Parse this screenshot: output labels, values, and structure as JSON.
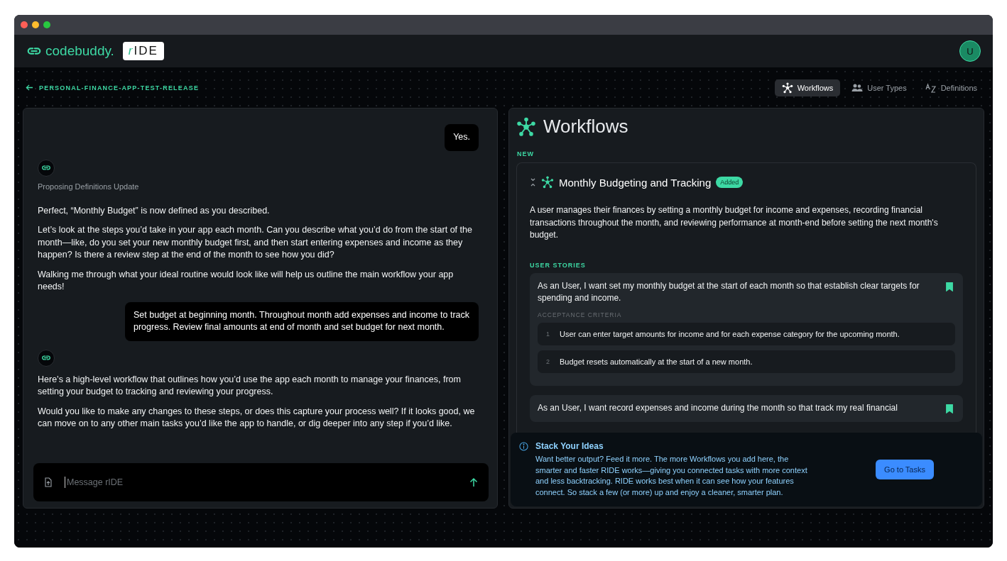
{
  "header": {
    "brand": "codebuddy.",
    "logo_prefix": "r",
    "logo_text": "IDE",
    "avatar": "U"
  },
  "breadcrumb": "PERSONAL-FINANCE-APP-TEST-RELEASE",
  "tabs": [
    {
      "kind": "workflows",
      "label": "Workflows",
      "selected": true
    },
    {
      "kind": "users",
      "label": "User Types",
      "selected": false
    },
    {
      "kind": "definitions",
      "label": "Definitions",
      "selected": false
    }
  ],
  "chat": {
    "messages": [
      {
        "kind": "user",
        "text": "Yes."
      },
      {
        "kind": "assistant",
        "status": "Proposing Definitions Update",
        "paragraphs": [
          "Perfect, “Monthly Budget” is now defined as you described.",
          "Let’s look at the steps you’d take in your app each month. Can you describe what you’d do from the start of the month—like, do you set your new monthly budget first, and then start entering expenses and income as they happen? Is there a review step at the end of the month to see how you did?",
          "Walking me through what your ideal routine would look like will help us outline the main workflow your app needs!"
        ]
      },
      {
        "kind": "user",
        "text": "Set budget at beginning month. Throughout month add expenses and income to track progress. Review final amounts at end of month and set budget for next month."
      },
      {
        "kind": "assistant",
        "paragraphs": [
          "Here’s a high-level workflow that outlines how you’d use the app each month to manage your finances, from setting your budget to tracking and reviewing your progress.",
          "Would you like to make any changes to these steps, or does this capture your process well? If it looks good, we can move on to any other main tasks you’d like the app to handle, or dig deeper into any step if you’d like."
        ]
      }
    ],
    "input": {
      "placeholder": "Message rIDE"
    }
  },
  "workflows": {
    "title": "Workflows",
    "section": "NEW",
    "workflow": {
      "name": "Monthly Budgeting and Tracking",
      "badge": "Added",
      "description": "A user manages their finances by setting a monthly budget for income and expenses, recording financial transactions throughout the month, and reviewing performance at month-end before setting the next month's budget.",
      "stories_label": "USER STORIES",
      "criteria_label": "ACCEPTANCE CRITERIA",
      "stories": [
        {
          "text": "As an User, I want set my monthly budget at the start of each month so that establish clear targets for spending and income.",
          "bookmarked": true,
          "criteria": [
            {
              "number": "1",
              "text": "User can enter target amounts for income and for each expense category for the upcoming month."
            },
            {
              "number": "2",
              "text": "Budget resets automatically at the start of a new month."
            }
          ]
        },
        {
          "text": "As an User, I want record expenses and income during the month so that track my real financial",
          "bookmarked": true
        }
      ]
    },
    "tip": {
      "title": "Stack Your Ideas",
      "text": "Want better output? Feed it more. The more Workflows you add here, the smarter and faster RIDE works—giving you connected tasks with more context and less backtracking. RIDE works best when it can see how your features connect. So stack a few (or more) up and enjoy a cleaner, smarter plan.",
      "button": "Go to Tasks"
    }
  }
}
